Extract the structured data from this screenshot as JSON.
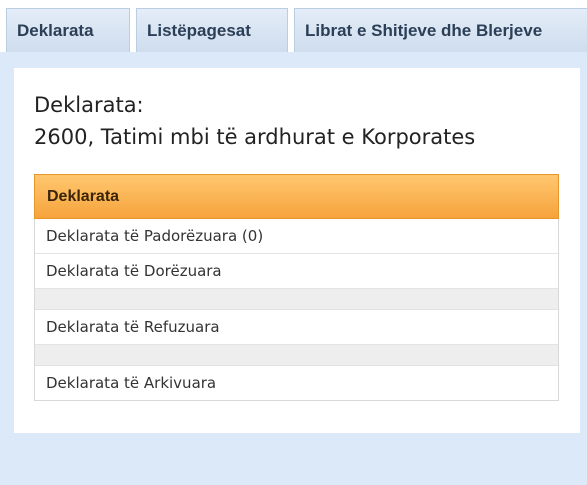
{
  "tabs": [
    {
      "label": "Deklarata"
    },
    {
      "label": "Listëpagesat"
    },
    {
      "label": "Librat e Shitjeve dhe Blerjeve"
    }
  ],
  "main": {
    "title_line1": "Deklarata:",
    "title_line2": "2600, Tatimi mbi të ardhurat e Korporates"
  },
  "declarations": {
    "header": "Deklarata",
    "items": [
      {
        "label": "Deklarata të Padorëzuara (0)"
      },
      {
        "label": "Deklarata të Dorëzuara"
      },
      {
        "label": "Deklarata të Refuzuara"
      },
      {
        "label": "Deklarata të Arkivuara"
      }
    ]
  },
  "colors": {
    "tab_background": "#d6e2f1",
    "content_background": "#dce9f8",
    "header_orange": "#f8ad4c",
    "row_spacer": "#eeeeee"
  }
}
